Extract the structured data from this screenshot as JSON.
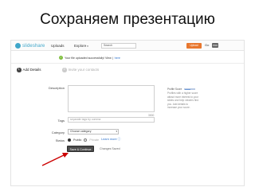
{
  "slide": {
    "title": "Сохраняем презентацию"
  },
  "topbar": {
    "logo_text": "slideshare",
    "nav_uploads": "Uploads",
    "nav_explore": "Explore",
    "explore_caret": "▾",
    "search_placeholder": "Search",
    "upload_label": "Upload",
    "goto_label": "Go",
    "pro_label": "PRO"
  },
  "notice": {
    "text": "Your file uploaded successfully! View |",
    "link": "here"
  },
  "steps": [
    {
      "num": "1",
      "label": "Add Details"
    },
    {
      "num": "2",
      "label": "Invite your contacts"
    }
  ],
  "form": {
    "description_label": "Description",
    "char_counter": "3000",
    "tags_label": "Tags",
    "tags_placeholder": "separate tags by comma",
    "category_label": "Category",
    "category_value": "Choose category",
    "status_label": "Status",
    "status_public": "Public",
    "status_private": "Private",
    "status_learn": "Learn more ⓘ",
    "save_label": "Save & Continue",
    "changes_label": "Changes Saved"
  },
  "sidebar": {
    "title": "Profile Score",
    "score_fraction": 0.6,
    "lines": [
      "Profiles with a higher score",
      "attract more interest to your",
      "slides and help viewers find",
      "you. Add details to",
      "increase your score."
    ]
  },
  "colors": {
    "accent": "#e8772e",
    "link": "#2a6fc9",
    "arrow": "#cc0000"
  }
}
